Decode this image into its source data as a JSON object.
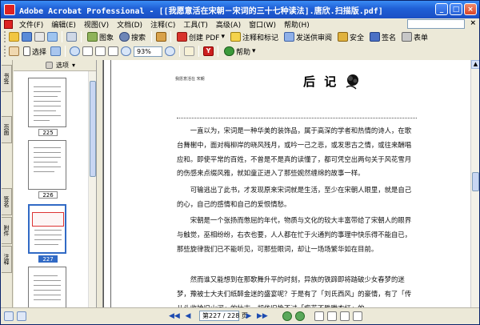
{
  "window": {
    "title": "Adobe Acrobat Professional - [[我愿意活在宋朝－宋词的三十七种读法].唐欣.扫描版.pdf]",
    "buttons": {
      "minimize": "_",
      "maximize": "□",
      "close": "×"
    }
  },
  "menu": {
    "items": [
      "文件(F)",
      "编辑(E)",
      "视图(V)",
      "文档(D)",
      "注释(C)",
      "工具(T)",
      "高级(A)",
      "窗口(W)",
      "帮助(H)"
    ],
    "help_field": "",
    "close": "×"
  },
  "toolbar1": {
    "search_label": "搜索",
    "image_label": "图象",
    "create_pdf": "创建 PDF",
    "comment_markup": "注释和标记",
    "send_review": "发送供审阅",
    "security": "安全",
    "sign": "签名",
    "forms": "表单"
  },
  "toolbar2": {
    "select_label": "选择",
    "zoom_value": "93%",
    "help_label": "帮助"
  },
  "nav_tabs": [
    "书签",
    "页面",
    "签名",
    "附件",
    "注释"
  ],
  "pages_panel": {
    "options_label": "选项",
    "thumbnails": [
      {
        "label": "225",
        "selected": false
      },
      {
        "label": "226",
        "selected": false
      },
      {
        "label": "227",
        "selected": true
      },
      {
        "label": "",
        "selected": false
      }
    ]
  },
  "document": {
    "running_head": "我愿意活在 宋朝",
    "chapter_title": "后 记",
    "paragraphs": [
      "一直以为，宋词是一种华美的装饰品，属于高深的学者和热情的诗人，在歌台舞榭中，面对梅柳岸的晓风残月，或吟一己之悲，或发思古之情，或往来酬唱应和。即使平常的百姓，不曾是不是真的读懂了，都可凭空出两句关于风花雪月的伤感来点缀风雅，就如童正进入了那些婉然缠绵的故事一样。",
      "可输逃出了此书，才发现原来宋词就是生活，至少在宋朝人眼里，就是自己的心，自己的感情和自己的爱恨情愁。",
      "宋朝是一个张扬而憋屈的年代，物质与文化的较大丰富带给了宋朝人的眼界与触觉，巫相纷纷，右衣也要，人人都在忙于火通判的事理中快乐得不能自已，那些旋律我们已不能听见，可那些眼词，却让一场场繁华如在目前。",
      "然而谁又能想到在那歌舞升平的时刻，异族的铁蹄即将踏破少女春梦的迷梦，豫被士大夫们纸醉金迷的盛宴呢？于是有了「刘氏西风」的豪情，有了「传从头收拾旧山河」的壮志，却依旧挽不过「瘦花不胜腾衣红」的"
    ]
  },
  "statusbar": {
    "page_field": "第227 / 228 页",
    "nav": {
      "first": "◀◀",
      "prev": "◀",
      "next": "▶",
      "last": "▶▶"
    }
  }
}
